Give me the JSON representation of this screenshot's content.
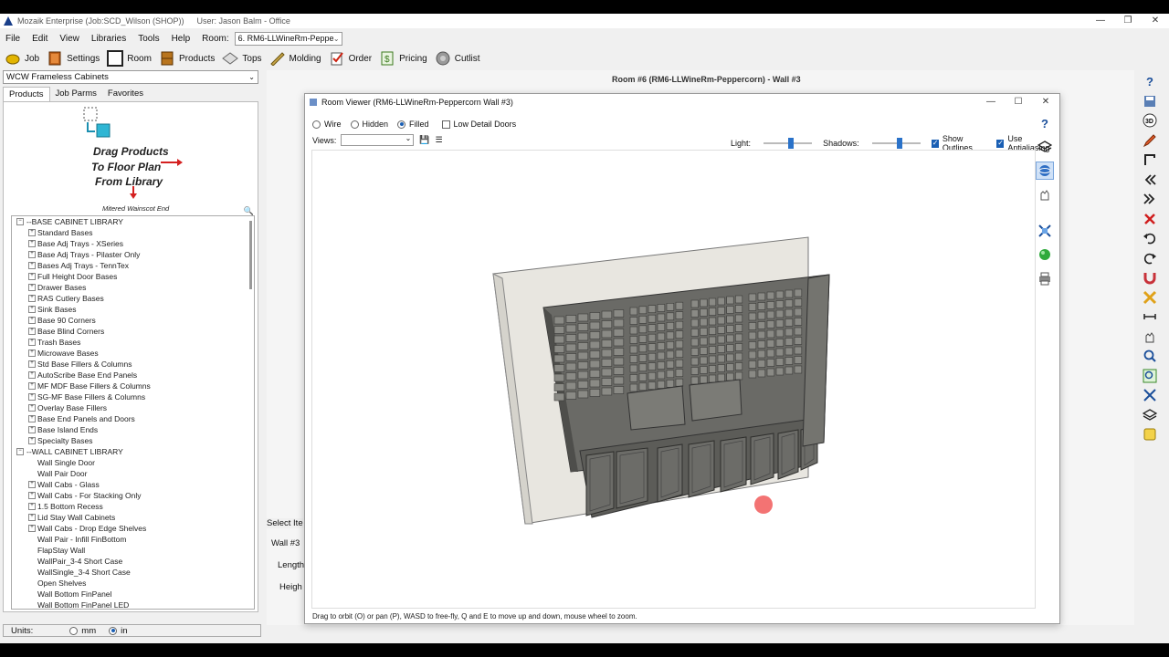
{
  "window": {
    "app_title": "Mozaik Enterprise (Job:SCD_Wilson (SHOP))",
    "user": "User: Jason Balm - Office"
  },
  "menu": [
    "File",
    "Edit",
    "View",
    "Libraries",
    "Tools",
    "Help"
  ],
  "room": {
    "label": "Room:",
    "value": "6. RM6-LLWineRm-Peppe"
  },
  "toolbar": [
    {
      "label": "Job",
      "icon": "job-icon"
    },
    {
      "label": "Settings",
      "icon": "settings-icon"
    },
    {
      "label": "Room",
      "icon": "room-icon"
    },
    {
      "label": "Products",
      "icon": "products-icon"
    },
    {
      "label": "Tops",
      "icon": "tops-icon"
    },
    {
      "label": "Molding",
      "icon": "molding-icon"
    },
    {
      "label": "Order",
      "icon": "order-icon"
    },
    {
      "label": "Pricing",
      "icon": "pricing-icon"
    },
    {
      "label": "Cutlist",
      "icon": "cutlist-icon"
    }
  ],
  "library_select": "WCW Frameless Cabinets",
  "tabs": [
    "Products",
    "Job Parms",
    "Favorites"
  ],
  "drag_hint": {
    "lines": [
      "Drag Products",
      "To Floor Plan",
      "From Library"
    ],
    "caption": "Mitered Wainscot End"
  },
  "tree": [
    {
      "type": "cat",
      "label": "--BASE CABINET LIBRARY"
    },
    {
      "type": "sub",
      "label": "Standard Bases",
      "plus": true
    },
    {
      "type": "sub",
      "label": "Base Adj Trays - XSeries",
      "plus": true
    },
    {
      "type": "sub",
      "label": "Base Adj Trays - Pilaster Only",
      "plus": true
    },
    {
      "type": "sub",
      "label": "Bases Adj Trays - TennTex",
      "plus": true
    },
    {
      "type": "sub",
      "label": "Full Height Door Bases",
      "plus": true
    },
    {
      "type": "sub",
      "label": "Drawer Bases",
      "plus": true
    },
    {
      "type": "sub",
      "label": "RAS Cutlery Bases",
      "plus": true
    },
    {
      "type": "sub",
      "label": "Sink Bases",
      "plus": true
    },
    {
      "type": "sub",
      "label": "Base 90 Corners",
      "plus": true
    },
    {
      "type": "sub",
      "label": "Base Blind Corners",
      "plus": true
    },
    {
      "type": "sub",
      "label": "Trash Bases",
      "plus": true
    },
    {
      "type": "sub",
      "label": "Microwave Bases",
      "plus": true
    },
    {
      "type": "sub",
      "label": "Std Base Fillers & Columns",
      "plus": true
    },
    {
      "type": "sub",
      "label": "AutoScribe Base End Panels",
      "plus": true
    },
    {
      "type": "sub",
      "label": "MF MDF Base Fillers & Columns",
      "plus": true
    },
    {
      "type": "sub",
      "label": "SG-MF Base Fillers & Columns",
      "plus": true
    },
    {
      "type": "sub",
      "label": "Overlay Base Fillers",
      "plus": true
    },
    {
      "type": "sub",
      "label": "Base End Panels and Doors",
      "plus": true
    },
    {
      "type": "sub",
      "label": "Base Island Ends",
      "plus": true
    },
    {
      "type": "sub",
      "label": "Specialty Bases",
      "plus": true
    },
    {
      "type": "cat",
      "label": "--WALL CABINET LIBRARY"
    },
    {
      "type": "sub",
      "label": "Wall Single Door",
      "plus": false
    },
    {
      "type": "sub",
      "label": "Wall Pair Door",
      "plus": false
    },
    {
      "type": "sub",
      "label": "Wall Cabs - Glass",
      "plus": true
    },
    {
      "type": "sub",
      "label": "Wall Cabs - For Stacking Only",
      "plus": true
    },
    {
      "type": "sub",
      "label": "1.5 Bottom Recess",
      "plus": true
    },
    {
      "type": "sub",
      "label": "Lid Stay Wall Cabinets",
      "plus": true
    },
    {
      "type": "sub",
      "label": "Wall Cabs - Drop Edge Shelves",
      "plus": true
    },
    {
      "type": "sub",
      "label": "Wall Pair - Infill FinBottom",
      "plus": false
    },
    {
      "type": "sub",
      "label": "FlapStay Wall",
      "plus": false
    },
    {
      "type": "sub",
      "label": "WallPair_3-4 Short Case",
      "plus": false
    },
    {
      "type": "sub",
      "label": "WallSingle_3-4 Short Case",
      "plus": false
    },
    {
      "type": "sub",
      "label": "Open Shelves",
      "plus": false
    },
    {
      "type": "sub",
      "label": "Wall Bottom FinPanel",
      "plus": false
    },
    {
      "type": "sub",
      "label": "Wall Bottom FinPanel LED",
      "plus": false
    }
  ],
  "units": {
    "label": "Units:",
    "mm": "mm",
    "in": "in",
    "selected": "in"
  },
  "background": {
    "heading": "Room #6 (RM6-LLWineRm-Peppercorn) - Wall #3",
    "select_item": "Select Ite",
    "wall": "Wall #3",
    "length": "Length",
    "height": "Heigh"
  },
  "viewer": {
    "title": "Room Viewer (RM6-LLWineRm-Peppercorn Wall #3)",
    "modes": [
      "Wire",
      "Hidden",
      "Filled"
    ],
    "selected_mode": "Filled",
    "low_detail": "Low Detail Doors",
    "views_label": "Views:",
    "light_label": "Light:",
    "light_level": 0.5,
    "shadows_label": "Shadows:",
    "shadows_level": 0.5,
    "show_outlines": "Show Outlines",
    "use_antialiasing": "Use Antialiasing",
    "status": "Drag to orbit (O) or pan (P), WASD to free-fly, Q and E to move up and down, mouse wheel to zoom."
  },
  "colors": {
    "accent": "#1a5fb4",
    "cabinet": "#5c5c58",
    "wall": "#e8e6e0"
  }
}
